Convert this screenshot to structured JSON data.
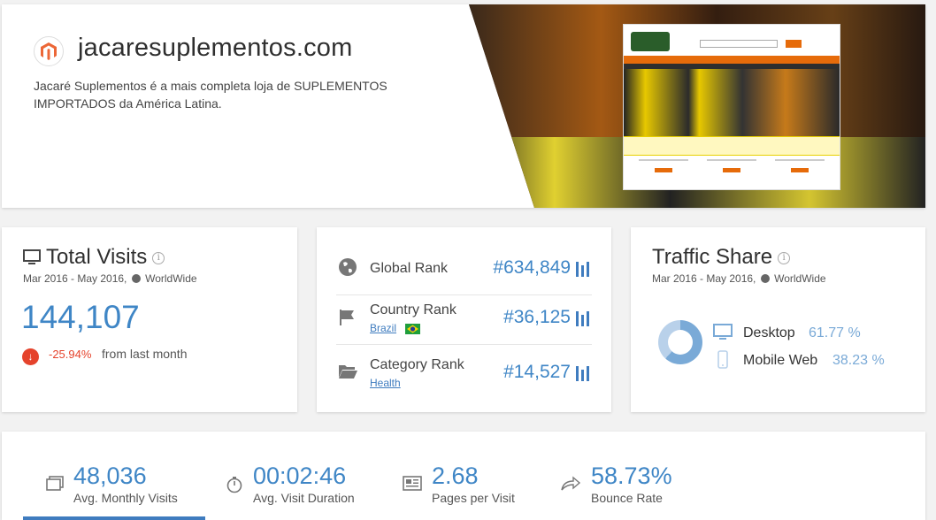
{
  "site": {
    "domain": "jacaresuplementos.com",
    "description": "Jacaré Suplementos é a mais completa loja de SUPLEMENTOS IMPORTADOS da América Latina.",
    "icon": "magento-icon"
  },
  "total_visits": {
    "title": "Total Visits",
    "date_range": "Mar 2016 - May 2016,",
    "region": "WorldWide",
    "value": "144,107",
    "change": "-25.94%",
    "change_label": "from last month",
    "colors": {
      "value": "#3f86c6",
      "negative": "#e5432c"
    }
  },
  "ranks": [
    {
      "label": "Global Rank",
      "value": "#634,849",
      "icon": "globe-icon",
      "link": ""
    },
    {
      "label": "Country Rank",
      "value": "#36,125",
      "icon": "flag-icon",
      "link": "Brazil",
      "flag": "brazil-flag-icon"
    },
    {
      "label": "Category Rank",
      "value": "#14,527",
      "icon": "folder-icon",
      "link": "Health"
    }
  ],
  "traffic_share": {
    "title": "Traffic Share",
    "date_range": "Mar 2016 - May 2016,",
    "region": "WorldWide",
    "items": [
      {
        "label": "Desktop",
        "value": "61.77 %",
        "fraction": 0.6177,
        "icon": "desktop-icon"
      },
      {
        "label": "Mobile Web",
        "value": "38.23 %",
        "fraction": 0.3823,
        "icon": "mobile-icon"
      }
    ]
  },
  "engagement": [
    {
      "value": "48,036",
      "label": "Avg. Monthly Visits",
      "icon": "monitor-stack-icon"
    },
    {
      "value": "00:02:46",
      "label": "Avg. Visit Duration",
      "icon": "stopwatch-icon"
    },
    {
      "value": "2.68",
      "label": "Pages per Visit",
      "icon": "pages-icon"
    },
    {
      "value": "58.73%",
      "label": "Bounce Rate",
      "icon": "bounce-arrow-icon"
    }
  ]
}
